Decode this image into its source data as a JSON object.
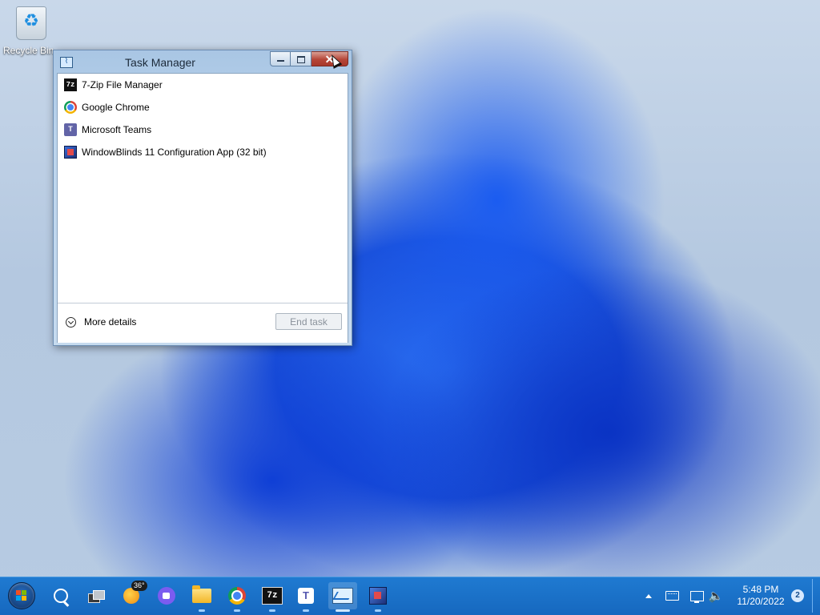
{
  "desktop": {
    "icons": [
      {
        "label": "Recycle Bin",
        "icon": "recycle-bin-icon"
      }
    ]
  },
  "window": {
    "title": "Task Manager",
    "icon": "task-manager-icon",
    "processes": [
      {
        "name": "7-Zip File Manager",
        "icon": "7zip-icon"
      },
      {
        "name": "Google Chrome",
        "icon": "chrome-icon"
      },
      {
        "name": "Microsoft Teams",
        "icon": "teams-icon"
      },
      {
        "name": "WindowBlinds 11 Configuration App (32 bit)",
        "icon": "windowblinds-icon"
      }
    ],
    "more_details": "More details",
    "end_task": "End task",
    "end_task_enabled": false
  },
  "taskbar": {
    "weather_temp": "36°",
    "pinned": [
      {
        "name": "start",
        "icon": "windows-start-icon"
      },
      {
        "name": "search",
        "icon": "search-icon"
      },
      {
        "name": "task-view",
        "icon": "task-view-icon"
      },
      {
        "name": "weather",
        "icon": "weather-icon"
      },
      {
        "name": "zoom",
        "icon": "video-meeting-icon"
      },
      {
        "name": "file-explorer",
        "icon": "folder-icon"
      },
      {
        "name": "chrome",
        "icon": "chrome-icon"
      },
      {
        "name": "7zip",
        "icon": "7zip-icon"
      },
      {
        "name": "teams",
        "icon": "teams-icon"
      },
      {
        "name": "task-manager",
        "icon": "task-manager-icon"
      },
      {
        "name": "windowblinds",
        "icon": "windowblinds-icon"
      }
    ],
    "apps": {
      "zip_label": "7z"
    },
    "tray": {
      "clock_time": "5:48 PM",
      "clock_date": "11/20/2022",
      "notification_count": "2"
    }
  },
  "colors": {
    "taskbar": "#1668bf",
    "close_button": "#b54638",
    "wallpaper_accent": "#1a4fd8"
  }
}
